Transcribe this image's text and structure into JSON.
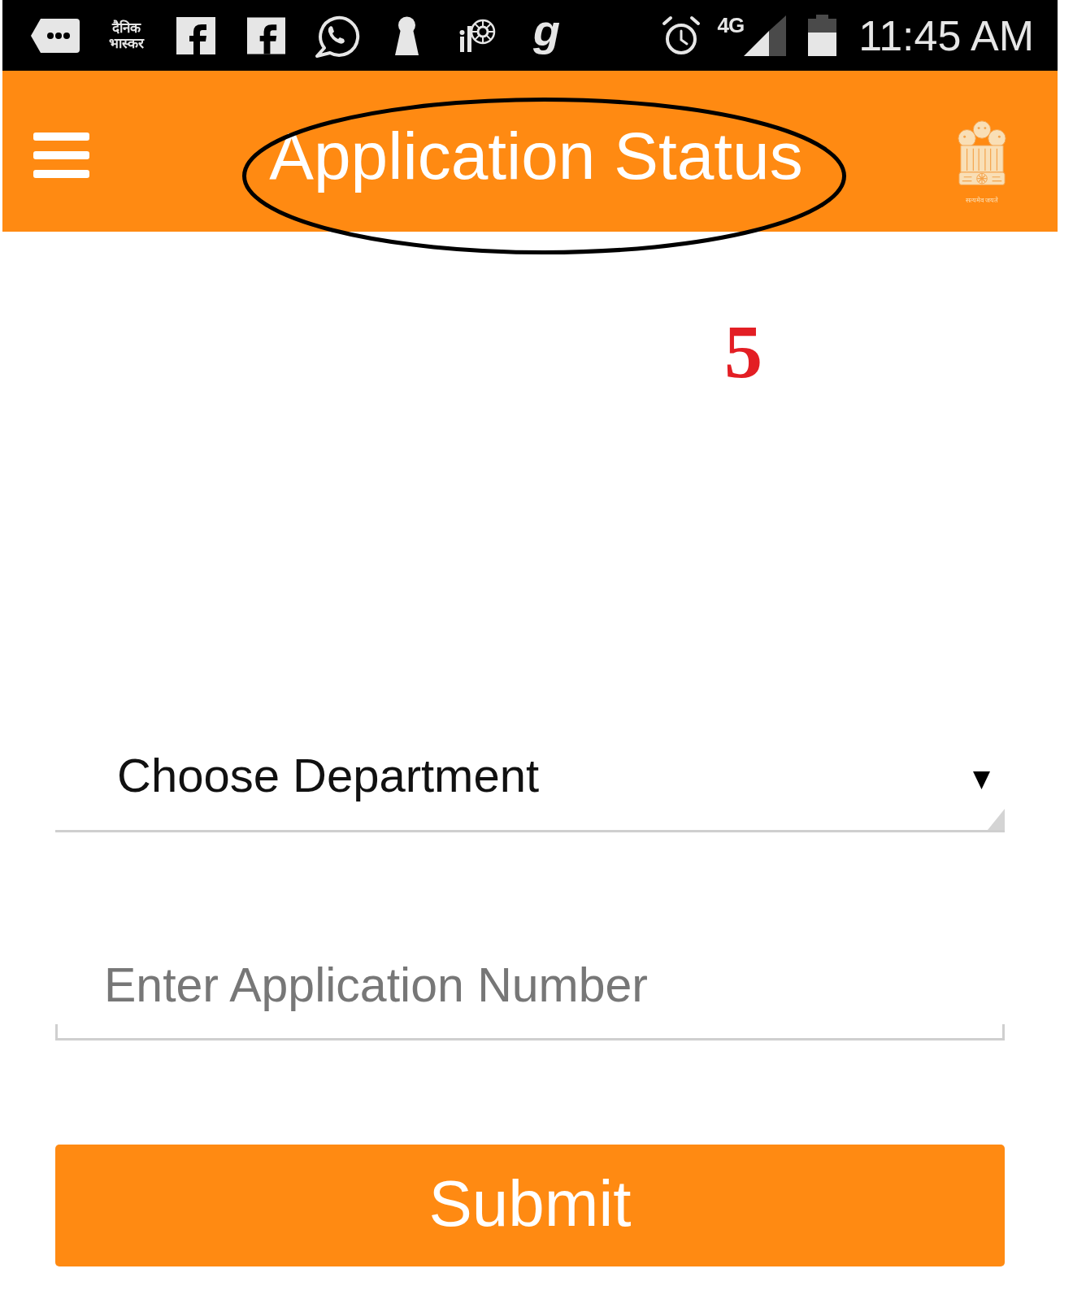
{
  "status_bar": {
    "logo_text": [
      "दैनिक",
      "भास्कर"
    ],
    "letter_logo": "g",
    "network_type": "4G",
    "time": "11:45 AM"
  },
  "header": {
    "title": "Application Status",
    "emblem_motto": "सत्यमेव जयते"
  },
  "annotations": [
    {
      "kind": "ellipse"
    },
    {
      "kind": "number",
      "text": "5"
    }
  ],
  "form": {
    "department_select": {
      "value": "Choose Department"
    },
    "application_number": {
      "placeholder": "Enter Application Number"
    },
    "submit_button": "Submit"
  }
}
